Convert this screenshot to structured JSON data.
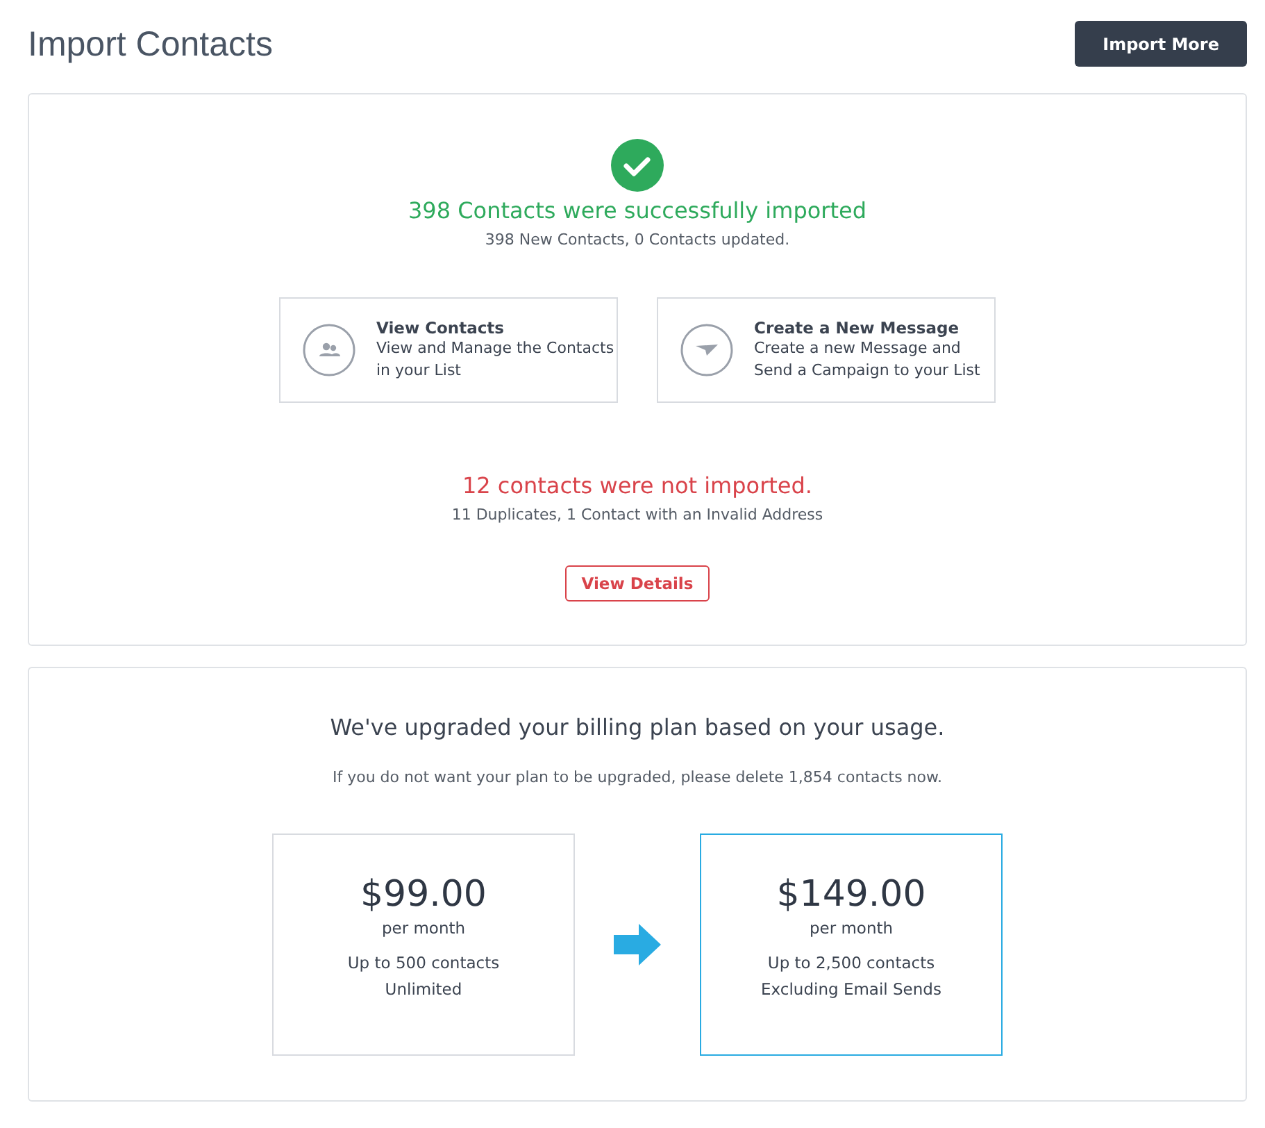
{
  "page": {
    "title": "Import Contacts",
    "action": "Import More"
  },
  "success": {
    "title": "398 Contacts were successfully imported",
    "detail": "398 New Contacts, 0 Contacts updated."
  },
  "actions": [
    {
      "kind": "contacts",
      "title": "View Contacts",
      "lines": [
        "View and Manage the Contacts",
        "in your List"
      ]
    },
    {
      "kind": "message",
      "title": "Create a New Message",
      "lines": [
        "Create a new Message and",
        "Send a Campaign to your List"
      ]
    }
  ],
  "failure": {
    "title": "12 contacts were not imported.",
    "detail": "11 Duplicates, 1 Contact with an Invalid Address",
    "button": "View Details"
  },
  "billing": {
    "title": "We've upgraded your billing plan based on your usage.",
    "note": "If you do not want your plan to be upgraded, please delete 1,854 contacts now.",
    "plans": [
      {
        "price": "$99.00",
        "period": "per month",
        "lines": [
          "Up to 500 contacts",
          "Unlimited"
        ],
        "selected": false
      },
      {
        "price": "$149.00",
        "period": "per month",
        "lines": [
          "Up to 2,500 contacts",
          "Excluding Email Sends"
        ],
        "selected": true
      }
    ]
  }
}
